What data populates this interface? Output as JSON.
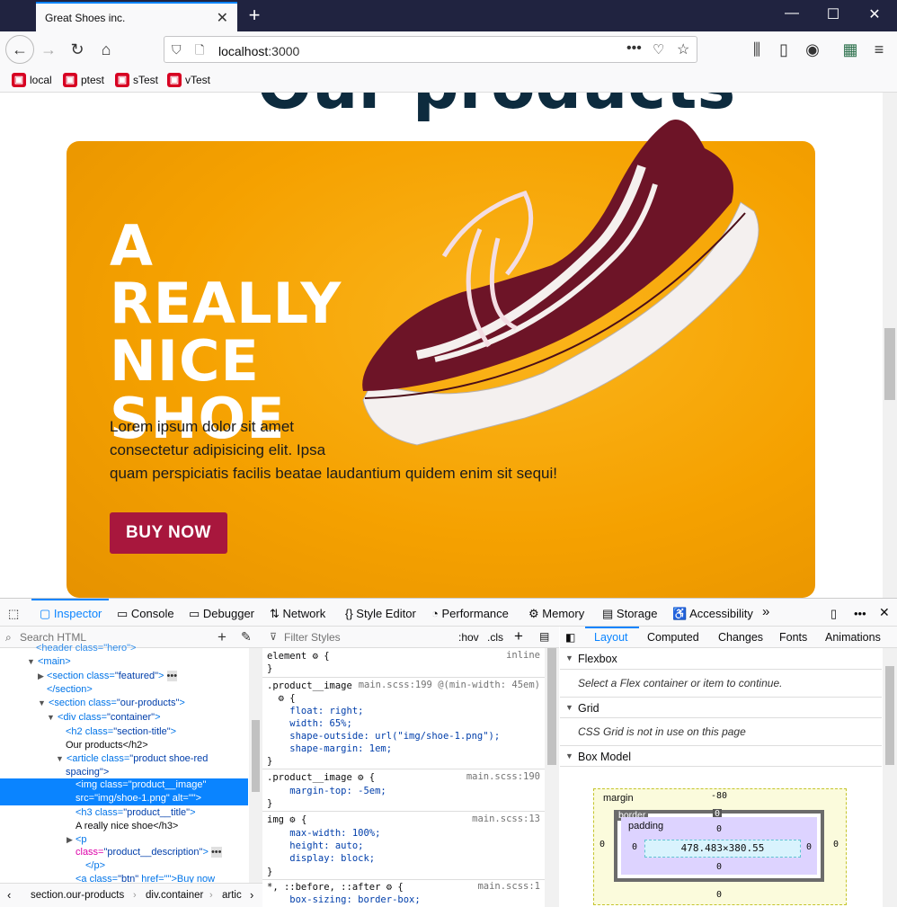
{
  "browser": {
    "tab_title": "Great Shoes inc.",
    "url_prefix": "localhost",
    "url_port": ":3000",
    "bookmarks": [
      "local",
      "ptest",
      "sTest",
      "vTest"
    ]
  },
  "page": {
    "heading_partial": "Our products",
    "hero_title_l1": "A REALLY",
    "hero_title_l2": "NICE",
    "hero_title_l3": "SHOE",
    "description_l1": "Lorem ipsum dolor sit amet",
    "description_l2": "consectetur adipisicing elit. Ipsa",
    "description_l3": "quam perspiciatis facilis beatae laudantium quidem enim sit sequi!",
    "buy_button": "BUY NOW",
    "card_color": "#f5a100",
    "button_color": "#a8173d"
  },
  "devtools": {
    "tabs": [
      "Inspector",
      "Console",
      "Debugger",
      "Network",
      "Style Editor",
      "Performance",
      "Memory",
      "Storage",
      "Accessibility"
    ],
    "search_placeholder": "Search HTML",
    "filter_placeholder": "Filter Styles",
    "hov": ":hov",
    "cls": ".cls",
    "tree": {
      "r0": "<header class=\"hero\">",
      "r1_tag": "<main>",
      "r2_a": "<section class=",
      "r2_b": "\"featured\"",
      "r2_c": ">",
      "r3": "</section>",
      "r4_a": "<section class=",
      "r4_b": "\"our-products\"",
      "r4_c": ">",
      "r5_a": "<div class=",
      "r5_b": "\"container\"",
      "r5_c": ">",
      "r6_a": "<h2 class=",
      "r6_b": "\"section-title\"",
      "r6_c": ">",
      "r7": "Our products</h2>",
      "r8_a": "<article class=",
      "r8_b": "\"product shoe-red",
      "r9": "spacing\">",
      "sel1": "<img class=\"product__image\"",
      "sel2": "src=\"img/shoe-1.png\" alt=\"\">",
      "r10_a": "<h3 class=",
      "r10_b": "\"product__title\"",
      "r10_c": ">",
      "r11": "A really nice shoe</h3>",
      "r12": "<p",
      "r13_a": "class=",
      "r13_b": "\"product__description\"",
      "r13_c": ">",
      "r14": "</p>",
      "r15_a": "<a class=",
      "r15_b": "\"btn\"",
      "r15_c": " href=\"\">Buy now"
    },
    "breadcrumb": [
      "section.our-products",
      "div.container",
      "artic"
    ],
    "rules": {
      "r1_sel": "element",
      "r1_src": "inline",
      "r2_sel": ".product__image",
      "r2_src": "main.scss:199 @(min-width: 45em)",
      "r2_body": "    float: right;\n    width: 65%;\n    shape-outside: url(\"img/shoe-1.png\");\n    shape-margin: 1em;",
      "r3_sel": ".product__image",
      "r3_src": "main.scss:190",
      "r3_body": "    margin-top: -5em;",
      "r4_sel": "img",
      "r4_src": "main.scss:13",
      "r4_body": "    max-width: 100%;\n    height: auto;\n    display: block;",
      "r5_sel": "*, ::before, ::after",
      "r5_src": "main.scss:1",
      "r5_body": "    box-sizing: border-box;"
    },
    "right_tabs": [
      "Layout",
      "Computed",
      "Changes",
      "Fonts",
      "Animations"
    ],
    "sections": {
      "flexbox": "Flexbox",
      "flexbox_msg": "Select a Flex container or item to continue.",
      "grid": "Grid",
      "grid_msg": "CSS Grid is not in use on this page",
      "boxmodel": "Box Model"
    },
    "box": {
      "margin_label": "margin",
      "margin_top": "-80",
      "border_label": "border",
      "padding_label": "padding",
      "content": "478.483×380.55",
      "zero": "0"
    }
  }
}
